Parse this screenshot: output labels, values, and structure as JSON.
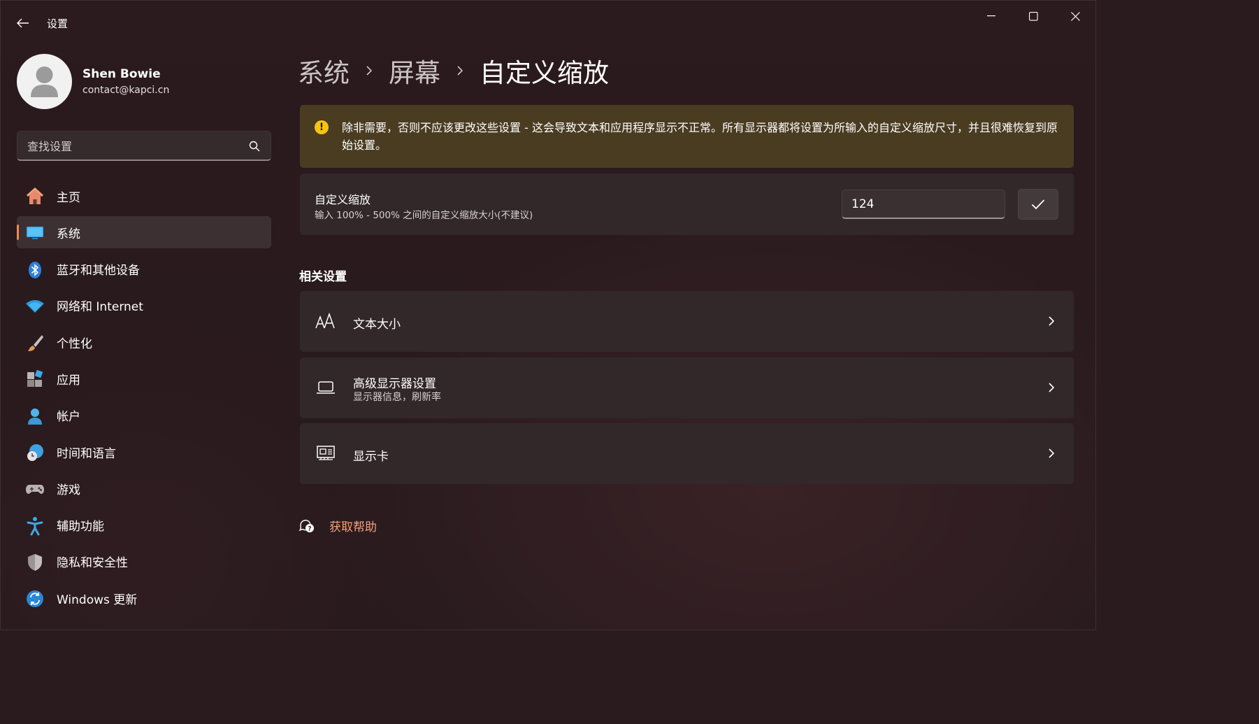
{
  "window": {
    "title": "设置",
    "controls": {
      "minimize": "minimize-icon",
      "maximize": "maximize-icon",
      "close": "close-icon"
    }
  },
  "user": {
    "name": "Shen Bowie",
    "email": "contact@kapci.cn"
  },
  "search": {
    "placeholder": "查找设置"
  },
  "sidebar": {
    "items": [
      {
        "label": "主页",
        "icon": "home-icon",
        "selected": false
      },
      {
        "label": "系统",
        "icon": "monitor-icon",
        "selected": true
      },
      {
        "label": "蓝牙和其他设备",
        "icon": "bluetooth-icon",
        "selected": false
      },
      {
        "label": "网络和 Internet",
        "icon": "wifi-icon",
        "selected": false
      },
      {
        "label": "个性化",
        "icon": "brush-icon",
        "selected": false
      },
      {
        "label": "应用",
        "icon": "apps-icon",
        "selected": false
      },
      {
        "label": "帐户",
        "icon": "account-icon",
        "selected": false
      },
      {
        "label": "时间和语言",
        "icon": "globe-clock-icon",
        "selected": false
      },
      {
        "label": "游戏",
        "icon": "gamepad-icon",
        "selected": false
      },
      {
        "label": "辅助功能",
        "icon": "accessibility-icon",
        "selected": false
      },
      {
        "label": "隐私和安全性",
        "icon": "shield-icon",
        "selected": false
      },
      {
        "label": "Windows 更新",
        "icon": "update-icon",
        "selected": false
      }
    ]
  },
  "breadcrumb": {
    "items": [
      "系统",
      "屏幕"
    ],
    "current": "自定义缩放"
  },
  "warning": {
    "text": "除非需要，否则不应该更改这些设置 - 这会导致文本和应用程序显示不正常。所有显示器都将设置为所输入的自定义缩放尺寸，并且很难恢复到原始设置。"
  },
  "custom_scale": {
    "title": "自定义缩放",
    "subtitle": "输入 100% - 500% 之间的自定义缩放大小(不建议)",
    "value": "124"
  },
  "related": {
    "title": "相关设置",
    "items": [
      {
        "title": "文本大小",
        "subtitle": "",
        "icon": "text-size-icon"
      },
      {
        "title": "高级显示器设置",
        "subtitle": "显示器信息，刷新率",
        "icon": "laptop-icon"
      },
      {
        "title": "显示卡",
        "subtitle": "",
        "icon": "graphics-card-icon"
      }
    ]
  },
  "help": {
    "label": "获取帮助"
  },
  "colors": {
    "accent": "#f08a55",
    "warning_bg": "#4a3c21",
    "warning_icon": "#f5c218",
    "link": "#f0a27a"
  }
}
